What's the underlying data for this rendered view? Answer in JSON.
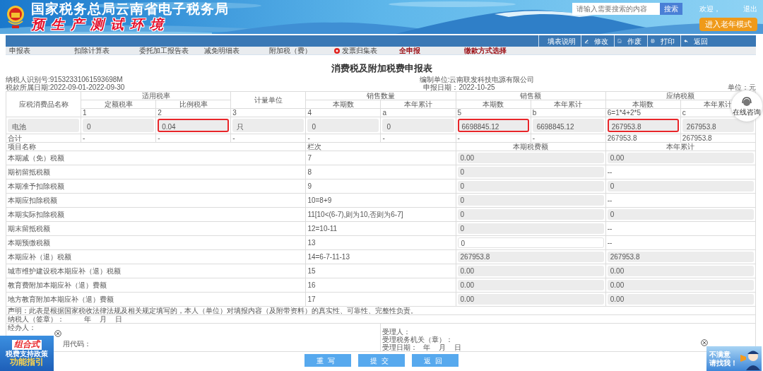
{
  "header": {
    "title": "国家税务总局云南省电子税务局",
    "subtitle": "预生产测试环境",
    "search": {
      "placeholder": "请输入需要搜索的内容",
      "button": "搜索"
    },
    "welcome": "欢迎，",
    "logout": "退出",
    "elder_mode": "进入老年模式"
  },
  "toolbar": [
    {
      "label": "填表说明",
      "kind": "guide"
    },
    {
      "label": "修改",
      "kind": "edit"
    },
    {
      "label": "作废",
      "kind": "void"
    },
    {
      "label": "打印",
      "kind": "print"
    },
    {
      "label": "返回",
      "kind": "back"
    }
  ],
  "tabs": [
    {
      "label": "申报表",
      "kind": "normal"
    },
    {
      "label": "扣除计算表",
      "kind": "normal"
    },
    {
      "label": "委托加工报告表",
      "kind": "normal"
    },
    {
      "label": "减免明细表",
      "kind": "normal"
    },
    {
      "label": "附加税（费）",
      "kind": "normal"
    },
    {
      "label": "发票归集表",
      "kind": "flagged"
    },
    {
      "label": "全申报",
      "kind": "emphasis"
    },
    {
      "label": "缴款方式选择",
      "kind": "emphasis"
    }
  ],
  "form": {
    "title": "消费税及附加税费申报表",
    "taxpayer_id": "纳税人识别号:91532331061593698M",
    "period": "税款所属日期:2022-09-01-2022-09-30",
    "company": "编制单位:云南联发科技电源有限公司",
    "filing_date": "申报日期：2022-10-25",
    "unit": "单位：元"
  },
  "goods_table": {
    "header_groups": [
      "应税消费品名称",
      "适用税率",
      "计量单位",
      "销售数量",
      "销售额",
      "应纳税额"
    ],
    "subheaders": [
      "定额税率",
      "比例税率",
      "本期数",
      "本年累计",
      "本期数",
      "本年累计",
      "本期数",
      "本年累计"
    ],
    "codes": [
      "1",
      "2",
      "3",
      "4",
      "a",
      "5",
      "b",
      "6=1*4+2*5",
      "c"
    ],
    "rows": [
      {
        "cells": [
          {
            "text": "电池",
            "highlighted": false
          },
          {
            "text": "0",
            "highlighted": false
          },
          {
            "text": "0.04",
            "highlighted": true
          },
          {
            "text": "只",
            "highlighted": false
          },
          {
            "text": "0",
            "highlighted": false
          },
          {
            "text": "0",
            "highlighted": false
          },
          {
            "text": "6698845.12",
            "highlighted": true
          },
          {
            "text": "6698845.12",
            "highlighted": false
          },
          {
            "text": "267953.8",
            "highlighted": true
          },
          {
            "text": "267953.8",
            "highlighted": false
          }
        ]
      }
    ],
    "total": [
      "合计",
      "-",
      "-",
      "-",
      "-",
      "-",
      "-",
      "-",
      "267953.8",
      "267953.8"
    ]
  },
  "items_table": {
    "columns": [
      "项目名称",
      "栏次",
      "本期税费额",
      "本年累计"
    ],
    "rows": [
      {
        "name": "本期减（免）税额",
        "code": "7",
        "current": {
          "text": "0.00",
          "kind": "readonly"
        },
        "year": {
          "text": "0.00",
          "kind": "readonly"
        }
      },
      {
        "name": "期初留抵税额",
        "code": "8",
        "current": {
          "text": "0",
          "kind": "readonly"
        },
        "year": {
          "text": "--",
          "kind": "plain"
        }
      },
      {
        "name": "本期准予扣除税额",
        "code": "9",
        "current": {
          "text": "0",
          "kind": "readonly"
        },
        "year": {
          "text": "0",
          "kind": "readonly"
        }
      },
      {
        "name": "本期应扣除税额",
        "code": "10=8+9",
        "current": {
          "text": "0",
          "kind": "readonly"
        },
        "year": {
          "text": "--",
          "kind": "plain"
        }
      },
      {
        "name": "本期实际扣除税额",
        "code": "11[10<(6-7),则为10,否则为6-7]",
        "current": {
          "text": "0",
          "kind": "readonly"
        },
        "year": {
          "text": "0",
          "kind": "readonly"
        }
      },
      {
        "name": "期末留抵税额",
        "code": "12=10-11",
        "current": {
          "text": "0",
          "kind": "readonly"
        },
        "year": {
          "text": "--",
          "kind": "plain"
        }
      },
      {
        "name": "本期预缴税额",
        "code": "13",
        "current": {
          "text": "0",
          "kind": "editable"
        },
        "year": {
          "text": "--",
          "kind": "plain"
        }
      },
      {
        "name": "本期应补（退）税额",
        "code": "14=6-7-11-13",
        "current": {
          "text": "267953.8",
          "kind": "readonly"
        },
        "year": {
          "text": "267953.8",
          "kind": "readonly"
        }
      },
      {
        "name": "城市维护建设税本期应补（退）税额",
        "code": "15",
        "current": {
          "text": "0.00",
          "kind": "readonly"
        },
        "year": {
          "text": "0.00",
          "kind": "readonly"
        }
      },
      {
        "name": "教育费附加本期应补（退）费额",
        "code": "16",
        "current": {
          "text": "0.00",
          "kind": "readonly"
        },
        "year": {
          "text": "0.00",
          "kind": "readonly"
        }
      },
      {
        "name": "地方教育附加本期应补（退）费额",
        "code": "17",
        "current": {
          "text": "0.00",
          "kind": "readonly"
        },
        "year": {
          "text": "0.00",
          "kind": "readonly"
        }
      }
    ]
  },
  "declaration": "声明：此表是根据国家税收法律法规及相关规定填写的，本人（单位）对填报内容（及附带资料）的真实性、可靠性、完整性负责。",
  "signature": {
    "label": "纳税人（签章）：",
    "year": "年",
    "month": "月",
    "day": "日"
  },
  "handler": [
    "经办人：",
    "用代码："
  ],
  "acceptance": {
    "receiver": "受理人：",
    "office": "受理税务机关（章）：",
    "date": "受理日期：",
    "year": "年",
    "month": "月",
    "day": "日"
  },
  "buttons": [
    "重写",
    "提交",
    "返回"
  ],
  "chat": {
    "label": "在线咨询"
  },
  "promo_left": {
    "lines": [
      "组合式",
      "税费支持政策",
      "功能指引"
    ]
  },
  "promo_right": {
    "lines": [
      "不满意",
      "请找我！"
    ]
  }
}
